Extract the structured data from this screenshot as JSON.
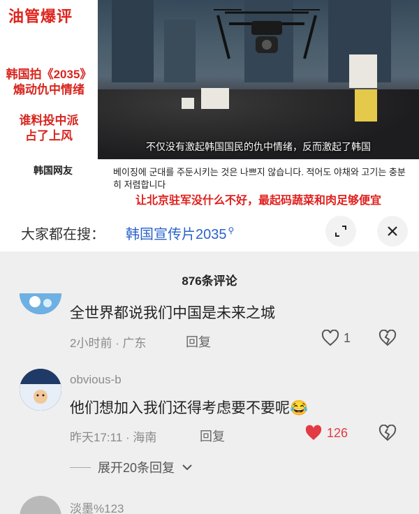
{
  "video": {
    "brand": "油管爆评",
    "left_red_lines": [
      "韩国拍《2035》\n煽动仇中情绪",
      "谁料投中派\n占了上风"
    ],
    "netizen_label": "韩国网友",
    "caption": "不仅没有激起韩国国民的仇中情绪，反而激起了韩国",
    "korean_text": "베이징에 군대를 주둔시키는 것은 나쁘지 않습니다. 적어도 야채와 고기는 충분히 저렴합니다",
    "chinese_translation": "让北京驻军没什么不好，最起码蔬菜和肉足够便宜"
  },
  "search": {
    "prefix": "大家都在搜：",
    "term": "韩国宣传片2035",
    "term_icon": "search-icon"
  },
  "comments_panel": {
    "title": "876条评论",
    "comments": [
      {
        "text": "全世界都说我们中国是未来之城",
        "time": "2小时前",
        "location": "广东",
        "meta": "2小时前 · 广东",
        "reply_label": "回复",
        "likes": "1",
        "liked": false
      },
      {
        "username": "obvious-b",
        "text": "他们想加入我们还得考虑要不要呢",
        "emoji": "😂",
        "time": "昨天17:11",
        "location": "海南",
        "meta": "昨天17:11 · 海南",
        "reply_label": "回复",
        "likes": "126",
        "liked": true,
        "expand_label": "展开20条回复"
      },
      {
        "username": "淡墨%123"
      }
    ]
  },
  "colors": {
    "accent_red": "#e0241e",
    "link_blue": "#2a62c9",
    "like_red": "#e23b44"
  }
}
